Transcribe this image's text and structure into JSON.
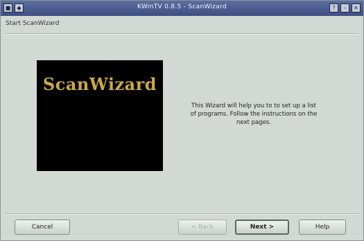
{
  "window": {
    "title": "KWinTV 0.8.5 - ScanWizard",
    "controls": {
      "menu_glyph": "■",
      "pin_glyph": "◆",
      "help_glyph": "?",
      "minimize_glyph": "–",
      "close_glyph": "✕"
    }
  },
  "page": {
    "subtitle": "Start ScanWizard",
    "logo_text": "ScanWizard",
    "description": "This Wizard will help you to to set up a list of programs. Follow the instructions on the next pages."
  },
  "buttons": {
    "cancel": "Cancel",
    "back": "< Back",
    "next": "Next >",
    "help": "Help"
  }
}
